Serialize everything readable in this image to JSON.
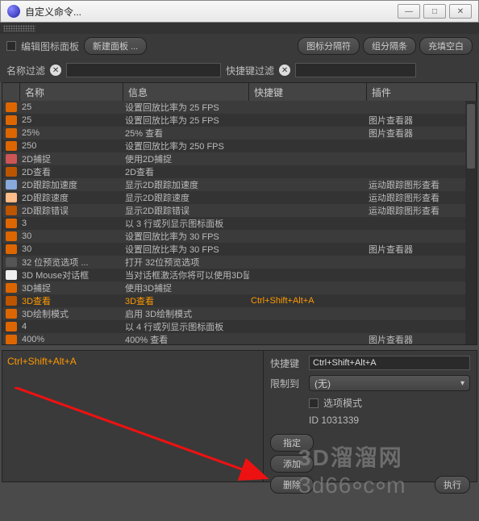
{
  "window": {
    "title": "自定义命令..."
  },
  "toolbar": {
    "editPanel": "编辑图标面板",
    "newPanel": "新建面板 ...",
    "iconSep": "图标分隔符",
    "groupSep": "组分隔条",
    "fillBlank": "充填空白"
  },
  "filters": {
    "nameLabel": "名称过滤",
    "shortcutLabel": "快捷键过滤"
  },
  "headers": {
    "name": "名称",
    "info": "信息",
    "shortcut": "快捷键",
    "plugin": "插件"
  },
  "rows": [
    {
      "ic": "#d60",
      "name": "25",
      "info": "设置回放比率为 25 FPS",
      "key": "",
      "plug": ""
    },
    {
      "ic": "#d60",
      "name": "25",
      "info": "设置回放比率为 25 FPS",
      "key": "",
      "plug": "图片查看器"
    },
    {
      "ic": "#d60",
      "name": "25%",
      "info": "25% 查看",
      "key": "",
      "plug": "图片查看器"
    },
    {
      "ic": "#d60",
      "name": "250",
      "info": "设置回放比率为 250 FPS",
      "key": "",
      "plug": ""
    },
    {
      "ic": "#c55",
      "name": "2D捕捉",
      "info": "使用2D捕捉",
      "key": "",
      "plug": ""
    },
    {
      "ic": "#b50",
      "name": "2D查看",
      "info": "2D查看",
      "key": "",
      "plug": ""
    },
    {
      "ic": "#8ad",
      "name": "2D跟踪加速度",
      "info": "显示2D跟踪加速度",
      "key": "",
      "plug": "运动跟踪图形查看"
    },
    {
      "ic": "#fb8",
      "name": "2D跟踪速度",
      "info": "显示2D跟踪速度",
      "key": "",
      "plug": "运动跟踪图形查看"
    },
    {
      "ic": "#b50",
      "name": "2D跟踪错误",
      "info": "显示2D跟踪错误",
      "key": "",
      "plug": "运动跟踪图形查看"
    },
    {
      "ic": "#d60",
      "name": "3",
      "info": "以 3 行或列显示图标面板",
      "key": "",
      "plug": ""
    },
    {
      "ic": "#d60",
      "name": "30",
      "info": "设置回放比率为 30 FPS",
      "key": "",
      "plug": ""
    },
    {
      "ic": "#d60",
      "name": "30",
      "info": "设置回放比率为 30 FPS",
      "key": "",
      "plug": "图片查看器"
    },
    {
      "ic": "#555",
      "name": "32 位预览选项 ...",
      "info": "打开 32位预览选项",
      "key": "",
      "plug": ""
    },
    {
      "ic": "#eee",
      "name": "3D Mouse对话框",
      "info": "当对话框激活你将可以使用3D鼠",
      "key": "",
      "plug": ""
    },
    {
      "ic": "#d60",
      "name": "3D捕捉",
      "info": "使用3D捕捉",
      "key": "",
      "plug": ""
    },
    {
      "ic": "#b50",
      "name": "3D查看",
      "info": "3D查看",
      "key": "Ctrl+Shift+Alt+A",
      "plug": "",
      "sel": true
    },
    {
      "ic": "#d60",
      "name": "3D绘制模式",
      "info": "启用 3D绘制模式",
      "key": "",
      "plug": ""
    },
    {
      "ic": "#d60",
      "name": "4",
      "info": "以 4 行或列显示图标面板",
      "key": "",
      "plug": ""
    },
    {
      "ic": "#d60",
      "name": "400%",
      "info": "400% 查看",
      "key": "",
      "plug": "图片查看器"
    }
  ],
  "bottom": {
    "currentShortcut": "Ctrl+Shift+Alt+A",
    "shortcutLabel": "快捷键",
    "shortcutValue": "Ctrl+Shift+Alt+A",
    "restrictLabel": "限制到",
    "restrictValue": "(无)",
    "optionMode": "选项模式",
    "idText": "ID 1031339",
    "assign": "指定",
    "add": "添加",
    "delete": "删除",
    "run": "执行"
  },
  "watermark": {
    "line1": "3D溜溜网",
    "line2": "3d66.com"
  }
}
